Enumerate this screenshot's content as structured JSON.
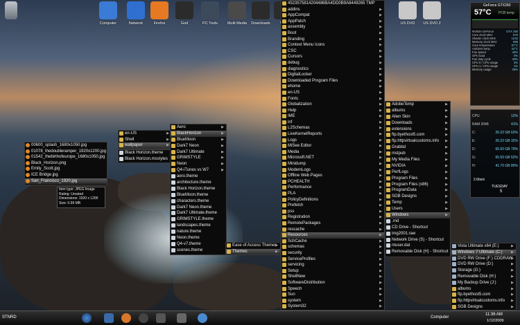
{
  "desktop": {
    "icons": [
      {
        "label": "Computer",
        "color": "#3a7bd5"
      },
      {
        "label": "Network",
        "color": "#2f6fd0"
      },
      {
        "label": "Firefox",
        "color": "#e67a22"
      },
      {
        "label": "God",
        "color": "#2b2b2b"
      },
      {
        "label": "PC Tools",
        "color": "#3d4a5c"
      },
      {
        "label": "Multi Media",
        "color": "#4a4a4a"
      },
      {
        "label": "Downloads",
        "color": "#2b2b2b"
      },
      {
        "label": "Wa",
        "color": "#2b2b2b"
      },
      {
        "label": "US DVD",
        "color": "#c8c8c8"
      },
      {
        "label": "US DVD 2",
        "color": "#c8c8c8"
      }
    ],
    "file_menu": {
      "items": [
        "00600_splash_1680x1050.jpg",
        "01078_thedoubleramper_1920x1200.jpg",
        "01542_thebirthofeurope_1680x1050.jpg",
        "Black_Horizon.png",
        "Emily_Scott.jpg",
        "ICE Bridge.jpg",
        "San_Francisco_1920.jpg"
      ]
    },
    "tooltip": [
      "Item type: JPEG Image",
      "Rating: Unrated",
      "Dimensions: 1920 x 1200",
      "Size: 0.99 MB"
    ],
    "menu1": {
      "items": [
        "en-US",
        "Shell",
        "wallpaper"
      ]
    },
    "menu2": {
      "items": [
        "Black Horizon.theme",
        "Black Horizon.msstyles"
      ]
    },
    "menu3": {
      "items": [
        "Aero",
        "BlackHorizon",
        "BlueMoon",
        "Dark7 Neon",
        "Dark7 Ultimate",
        "GRIMSTYLE",
        "Neon",
        "Q4-iTunes vs W7",
        "aero.theme",
        "architecture.theme",
        "Black Horizon.theme",
        "BlueMoon.theme",
        "characters.theme",
        "Dark7 Neon.theme",
        "Dark7 Ultimate.theme",
        "GRIMSTYLE.theme",
        "landscapes.theme",
        "nature.theme",
        "Neon.theme",
        "Q4-v7.theme",
        "scenes.theme"
      ]
    },
    "menu4": {
      "items": [
        "Ease of Access Themes",
        "Themes"
      ]
    },
    "big_menu": {
      "items": [
        "4523575814204486BA4DD0B9A8449265 TMP",
        "addins",
        "AppCompat",
        "AppPatch",
        "assembly",
        "Boot",
        "Branding",
        "Context Menu Icons",
        "CSC",
        "Cursors",
        "debug",
        "diagnostics",
        "DigitalLocker",
        "Downloaded Program Files",
        "ehome",
        "en-US",
        "Fonts",
        "Globalization",
        "Help",
        "IME",
        "inf",
        "L2Schemas",
        "LiveKernelReports",
        "Logs",
        "MiSee Editor",
        "Media",
        "Microsoft.NET",
        "Minidump",
        "ModemLogs",
        "Offline Web Pages",
        "PCHEALTH",
        "Performance",
        "PLA",
        "PolicyDefinitions",
        "Prefetch",
        "pss",
        "Registration",
        "RemotePackages",
        "rescache",
        "Resources",
        "SchCache",
        "schemas",
        "security",
        "ServiceProfiles",
        "servicing",
        "Setup",
        "ShellNew",
        "SoftwareDistribution",
        "Speech",
        "Sun",
        "system",
        "System32"
      ]
    },
    "user_menu": {
      "items": [
        "AdobeTemp",
        "albums",
        "Alien Skin",
        "Downloads",
        "extensions",
        "ftp.byethost5.com",
        "ftp.httpvirtualcustoms.info",
        "Grabbd",
        "mstpub",
        "My Media Files",
        "NVIDIA",
        "PerfLogs",
        "Program Files",
        "Program Files (x86)",
        "ProgramData",
        "SGB Designs",
        "Temp",
        "Users",
        "Windows",
        ".rnd",
        "CD Drive - Shortcut",
        "img2001.raw",
        "Network Drive (S) - Shortcut",
        "ntuser.dat",
        "Removable Disk (H) - Shortcut"
      ]
    },
    "drive_menu": {
      "items": [
        "Vista Ultimate x64 (E:)",
        "Windows 7 Ultimate (C:)",
        "DVD RW Drive (F:) CDDRAW",
        "DVD RW Drive (D:)",
        "Storage (G:)",
        "Removable Disk (H:)",
        "My Backup Drive (J:)",
        "albums",
        "ftp.byethost5.com",
        "ftp.httpvirtualcustoms.info",
        "SGB Designs"
      ]
    }
  },
  "gadgets": {
    "gpu_title": "GeForce GTX260",
    "gpu_temp": "57°C",
    "gpu_sub": "PCB temp",
    "gpu_rows": [
      [
        "NVIDIA GeForce",
        "GTX 260"
      ],
      [
        "Core clock MHz",
        "576"
      ],
      [
        "Shader clock MHz",
        "1242"
      ],
      [
        "Memory clock MHz",
        "999"
      ],
      [
        "Core temperature",
        "57°C"
      ],
      [
        "Ambient temp",
        "42°C"
      ],
      [
        "Fan speed",
        "40%"
      ],
      [
        "GPU load",
        "0%"
      ],
      [
        "Fan duty cycle",
        "40%"
      ],
      [
        "CPU 0 / CPU usage",
        "3%"
      ],
      [
        "CPU 1 / CPU usage",
        "1%"
      ],
      [
        "Memory usage",
        "35%"
      ]
    ],
    "cpu_rows": [
      [
        "CPU",
        "12%"
      ],
      [
        "RAM 2048",
        "41%"
      ],
      [
        "C:",
        "26.22 GB 62%"
      ],
      [
        "E:",
        "26.22 GB 32%"
      ],
      [
        "D:",
        "65.50 GB 70%"
      ],
      [
        "G:",
        "65.50 GB 52%"
      ],
      [
        "H:",
        "41.70 GB 80%"
      ]
    ],
    "net": "2.6bs/s",
    "day": "TUESDAY",
    "date": "5"
  },
  "taskbar": {
    "start_label": "STNRD",
    "computer_label": "Computer",
    "time": "11:36 AM",
    "date": "1/12/2009"
  }
}
